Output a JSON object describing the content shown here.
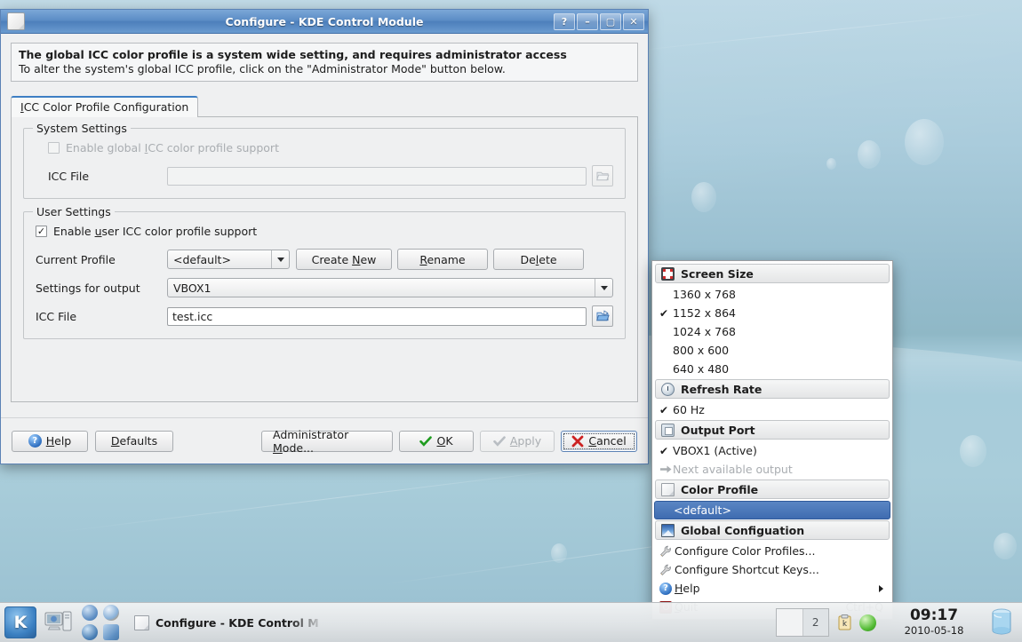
{
  "window": {
    "title": "Configure - KDE Control Module",
    "buttons": {
      "help": "?",
      "minimize": "–",
      "maximize": "▢",
      "close": "✕"
    }
  },
  "info": {
    "headline": "The global ICC color profile is a system wide setting, and requires administrator access",
    "detail": "To alter the system's global ICC profile, click on the \"Administrator Mode\" button below."
  },
  "tab": {
    "label": "ICC Color Profile Configuration"
  },
  "system_settings": {
    "group_label": "System Settings",
    "enable_checkbox": {
      "label_pre": "Enable global ",
      "label_accel": "I",
      "label_post": "CC color profile support",
      "checked": false,
      "enabled": false
    },
    "icc_file_label": "ICC File",
    "icc_file_value": "",
    "browse_tooltip": "Browse"
  },
  "user_settings": {
    "group_label": "User Settings",
    "enable_checkbox": {
      "label_pre": "Enable ",
      "label_accel": "u",
      "label_post": "ser ICC color profile support",
      "checked": true,
      "enabled": true
    },
    "current_profile_label": "Current Profile",
    "current_profile_value": "<default>",
    "create_new": {
      "pre": "Create ",
      "accel": "N",
      "post": "ew"
    },
    "rename": {
      "pre": "",
      "accel": "R",
      "post": "ename"
    },
    "delete": {
      "pre": "De",
      "accel": "l",
      "post": "ete"
    },
    "settings_for_output_label": "Settings for output",
    "settings_for_output_value": "VBOX1",
    "icc_file_label": "ICC File",
    "icc_file_value": "test.icc"
  },
  "dialog_buttons": {
    "help": {
      "pre": "",
      "accel": "H",
      "post": "elp"
    },
    "defaults": {
      "pre": "",
      "accel": "D",
      "post": "efaults"
    },
    "admin_mode": {
      "pre": "Administrator ",
      "accel": "M",
      "post": "ode..."
    },
    "ok": {
      "pre": "",
      "accel": "O",
      "post": "K"
    },
    "apply": {
      "pre": "",
      "accel": "A",
      "post": "pply",
      "enabled": false
    },
    "cancel": {
      "pre": "",
      "accel": "C",
      "post": "ancel",
      "focused": true
    }
  },
  "popup_menu": {
    "sections": [
      {
        "header": "Screen Size",
        "header_icon": "screen-size-icon",
        "items": [
          {
            "label": "1360 x 768",
            "checked": false
          },
          {
            "label": "1152 x 864",
            "checked": true
          },
          {
            "label": "1024 x 768",
            "checked": false
          },
          {
            "label": "800 x 600",
            "checked": false
          },
          {
            "label": "640 x 480",
            "checked": false
          }
        ]
      },
      {
        "header": "Refresh Rate",
        "header_icon": "clock-icon",
        "items": [
          {
            "label": "60 Hz",
            "checked": true
          }
        ]
      },
      {
        "header": "Output Port",
        "header_icon": "output-port-icon",
        "items": [
          {
            "label": "VBOX1 (Active)",
            "checked": true
          },
          {
            "label": "Next available output",
            "checked": false,
            "disabled": true,
            "icon": "arrow-right-icon"
          }
        ]
      },
      {
        "header": "Color Profile",
        "header_icon": "document-icon",
        "items": [
          {
            "label": "<default>",
            "selected": true
          }
        ]
      },
      {
        "header": "Global Configuation",
        "header_icon": "global-config-icon",
        "items": [
          {
            "label": "Configure Color Profiles...",
            "icon": "wrench-icon"
          },
          {
            "label": "Configure Shortcut Keys...",
            "icon": "wrench-icon"
          },
          {
            "label": "Help",
            "icon": "help-icon",
            "submenu": true,
            "accel_letter": "H"
          },
          {
            "label": "Quit",
            "icon": "quit-icon",
            "shortcut": "Ctrl+Q",
            "accel_letter": "Q"
          }
        ]
      }
    ]
  },
  "panel": {
    "kmenu_label": "K",
    "task_title": "Configure - KDE Control M",
    "pager_current": "2",
    "clock_time": "09:17",
    "clock_date": "2010-05-18"
  },
  "colors": {
    "title_bar": "#5c8dc6",
    "selection": "#3f6cb0",
    "dialog_bg": "#eff0f1",
    "desktop": "#9fc4d6"
  }
}
